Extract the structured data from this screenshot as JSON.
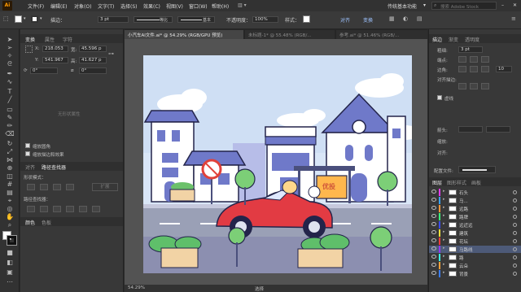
{
  "menubar": {
    "items": [
      "文件(F)",
      "编辑(E)",
      "对象(O)",
      "文字(T)",
      "选择(S)",
      "效果(C)",
      "视图(V)",
      "窗口(W)",
      "帮助(H)"
    ],
    "workspace": "传统基本功能",
    "search_placeholder": "搜索 Adobe Stock"
  },
  "control": {
    "stroke_label": "描边：",
    "stroke_value": "3 pt",
    "profile_label": "等比",
    "brush_label": "基本",
    "opacity_label": "不透明度：",
    "opacity_value": "100%",
    "style_label": "样式：",
    "align_label": "对齐",
    "transform_label": "变换"
  },
  "leftpanel": {
    "tabs": [
      "变换",
      "属性",
      "字符"
    ],
    "x_label": "X:",
    "x_value": "218.053",
    "y_label": "Y:",
    "y_value": "541.967",
    "w_label": "宽:",
    "w_value": "45.596 p",
    "h_label": "高:",
    "h_value": "41.627 p",
    "angle1": "0°",
    "angle2": "0°",
    "no_shape": "无形状属性",
    "cb1": "缩放圆角",
    "cb2": "缩放描边和效果",
    "tabs2": [
      "对齐",
      "路径查找器"
    ],
    "shape_mode": "形状模式：",
    "expand": "扩展",
    "pathfinder": "路径查找器：",
    "tabs3": [
      "颜色",
      "色板"
    ]
  },
  "doctabs": [
    "小汽车AI文件.ai* @ 54.29% (RGB/GPU 预览)",
    "未标题-1* @ 55.48% (RGB/...",
    "参考.ai* @ 51.46% (RGB/..."
  ],
  "status": {
    "zoom": "54.29%",
    "tool": "选择"
  },
  "art": {
    "sign_brand": "优投"
  },
  "rightpanel": {
    "tabs": [
      "描边",
      "渐变",
      "透明度"
    ],
    "weight_label": "粗细:",
    "weight_value": "3 pt",
    "cap_label": "端点:",
    "corner_label": "边角:",
    "limit_value": "10",
    "align_label": "对齐描边:",
    "dashed_label": "虚线",
    "arrow_label": "箭头:",
    "scale_label": "缩放:",
    "align2_label": "对齐:",
    "profile_label": "配置文件:",
    "layer_tabs": [
      "图层",
      "图形样式",
      "画板"
    ],
    "layers": [
      {
        "name": "石头",
        "color": "#e23bf0",
        "selected": false
      },
      {
        "name": "马...",
        "color": "#3ba1f0",
        "selected": false
      },
      {
        "name": "远路",
        "color": "#f0963b",
        "selected": false
      },
      {
        "name": "路牌",
        "color": "#3bf07a",
        "selected": false
      },
      {
        "name": "远近远",
        "color": "#3b4cf0",
        "selected": false
      },
      {
        "name": "建筑",
        "color": "#f0e13b",
        "selected": false
      },
      {
        "name": "花坛",
        "color": "#f03b3b",
        "selected": false
      },
      {
        "name": "马路线",
        "color": "#8f3bf0",
        "selected": true
      },
      {
        "name": "路",
        "color": "#3bf0e5",
        "selected": false
      },
      {
        "name": "云朵",
        "color": "#f0a03b",
        "selected": false
      },
      {
        "name": "背景",
        "color": "#3b7cf0",
        "selected": false
      }
    ]
  }
}
